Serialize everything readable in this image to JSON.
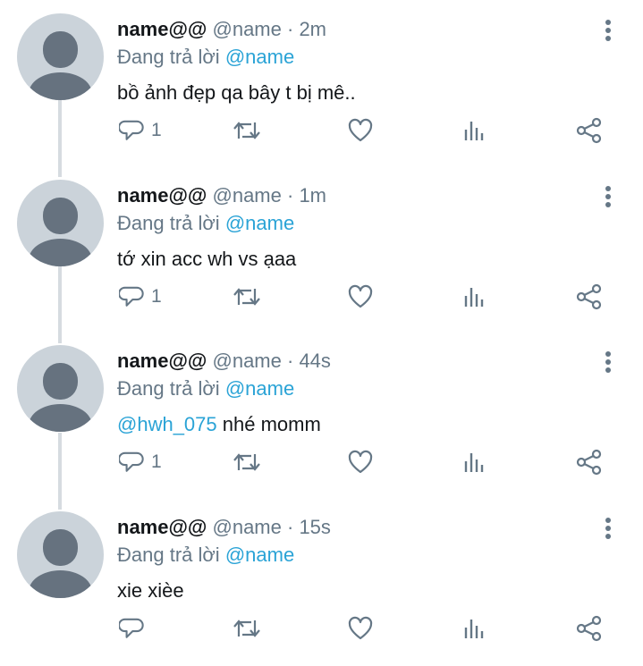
{
  "replying_prefix": "Đang trả lời",
  "tweets": [
    {
      "name": "name@@",
      "handle": "@name",
      "time": "2m",
      "reply_to": "@name",
      "mention": "",
      "text": "bồ ảnh đẹp qa bây t bị mê..",
      "reply_count": "1"
    },
    {
      "name": "name@@",
      "handle": "@name",
      "time": "1m",
      "reply_to": "@name",
      "mention": "",
      "text": "tớ xin acc wh vs ạaa",
      "reply_count": "1"
    },
    {
      "name": "name@@",
      "handle": "@name",
      "time": "44s",
      "reply_to": "@name",
      "mention": "@hwh_075",
      "text": " nhé momm",
      "reply_count": "1"
    },
    {
      "name": "name@@",
      "handle": "@name",
      "time": "15s",
      "reply_to": "@name",
      "mention": "",
      "text": "xie xièe",
      "reply_count": ""
    }
  ],
  "icons": {
    "reply": "reply-bubble-icon",
    "retweet": "retweet-icon",
    "like": "heart-icon",
    "stats": "bar-chart-icon",
    "share": "share-icon",
    "more": "more-vertical-icon"
  },
  "colors": {
    "link": "#2aa3d6",
    "secondary_text": "#657786",
    "primary_text": "#14171a",
    "thread_line": "#d6dbe0",
    "avatar_bg": "#cbd3da",
    "avatar_fg": "#66727f"
  }
}
